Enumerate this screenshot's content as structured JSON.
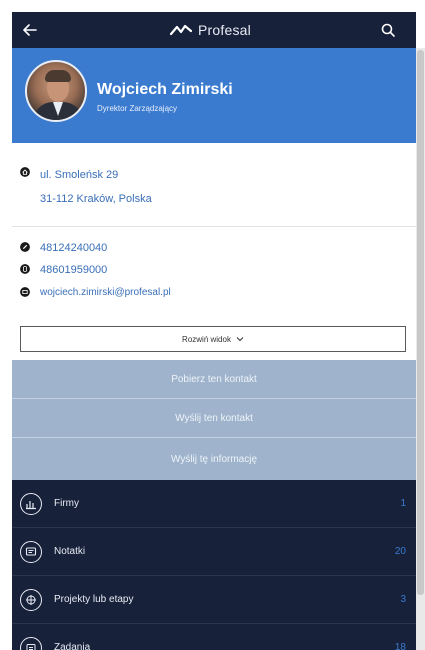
{
  "topbar": {
    "back_icon": "arrow-left-icon",
    "brand": "Profesal",
    "search_icon": "search-icon"
  },
  "profile": {
    "name": "Wojciech Zimirski",
    "role": "Dyrektor Zarządzający"
  },
  "address": {
    "line1": "ul. Smoleńsk 29",
    "line2": "31-112 Kraków, Polska"
  },
  "contacts": {
    "phone1": "48124240040",
    "phone2": "48601959000",
    "email": "wojciech.zimirski@profesal.pl"
  },
  "expand_label": "Rozwiń widok",
  "actions": [
    {
      "label": "Pobierz ten kontakt"
    },
    {
      "label": "Wyślij ten kontakt"
    },
    {
      "label": "Wyślij tę informację"
    }
  ],
  "list": [
    {
      "label": "Firmy",
      "count": "1",
      "icon": "company-chart-icon"
    },
    {
      "label": "Notatki",
      "count": "20",
      "icon": "notes-icon"
    },
    {
      "label": "Projekty lub etapy",
      "count": "3",
      "icon": "projects-icon"
    },
    {
      "label": "Zadania",
      "count": "18",
      "icon": "tasks-icon"
    }
  ],
  "colors": {
    "topbar": "#17213a",
    "profile_bg": "#3a7bd0",
    "action_bg": "#9fb4cc",
    "link": "#3a6fb8"
  }
}
